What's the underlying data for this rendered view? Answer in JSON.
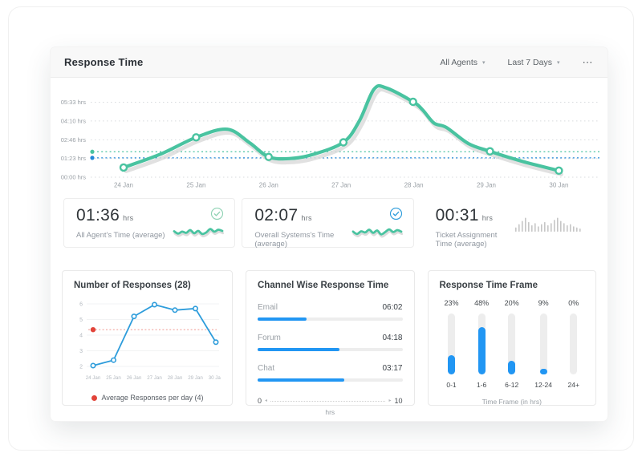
{
  "header": {
    "title": "Response Time",
    "filters": [
      {
        "label": "All Agents"
      },
      {
        "label": "Last 7 Days"
      }
    ],
    "menu_icon": "⋯"
  },
  "colors": {
    "teal": "#49c3a0",
    "teal_icon": "#8fd2b4",
    "blue": "#2196f3",
    "blue_line": "#2d9cdb",
    "ref_blue": "#2488d8",
    "red": "#e2443a",
    "red_light": "#f2a59f",
    "shadow_gray": "#dcdcdc",
    "waveform_gray": "#c6c6c6"
  },
  "stats": [
    {
      "value": "01:36",
      "unit": "hrs",
      "label": "All Agent's Time (average)",
      "icon": "check-circle",
      "icon_color": "#8fd2b4",
      "spark": [
        4.6,
        3.4,
        4.4,
        3.8,
        5.2,
        3.6,
        4.8,
        3.2,
        4.0,
        5.8,
        4.4,
        5.4,
        4.8
      ]
    },
    {
      "value": "02:07",
      "unit": "hrs",
      "label": "Overall Systems's Time (average)",
      "icon": "check-circle",
      "icon_color": "#2d9cdb",
      "spark": [
        4.4,
        3.2,
        4.6,
        4.0,
        5.4,
        3.8,
        5.0,
        3.0,
        4.2,
        5.6,
        4.2,
        5.2,
        4.4
      ]
    },
    {
      "value": "00:31",
      "unit": "hrs",
      "label": "Ticket Assignment Time (average)",
      "icon": "waveform",
      "waveform": [
        4,
        7,
        10,
        13,
        9,
        6,
        8,
        5,
        7,
        9,
        6,
        8,
        11,
        13,
        10,
        8,
        6,
        7,
        5,
        4,
        3
      ]
    }
  ],
  "chart_data": [
    {
      "id": "response_trend",
      "type": "line",
      "title": "Response Time",
      "x_labels": [
        "24 Jan",
        "25 Jan",
        "26 Jan",
        "27 Jan",
        "28 Jan",
        "29 Jan",
        "30 Jan"
      ],
      "y_tick_labels": [
        "05:33 hrs",
        "04:10 hrs",
        "02:46 hrs",
        "01:23 hrs",
        "00:00 hrs"
      ],
      "y_tick_minutes": [
        333,
        250,
        166,
        83,
        0
      ],
      "day_values_minutes": [
        43,
        177,
        90,
        155,
        335,
        115,
        29
      ],
      "curve": [
        [
          0,
          43
        ],
        [
          0.5,
          101
        ],
        [
          1,
          177
        ],
        [
          1.43,
          213
        ],
        [
          1.74,
          152
        ],
        [
          2,
          90
        ],
        [
          2.3,
          83
        ],
        [
          2.6,
          100
        ],
        [
          3.03,
          155
        ],
        [
          3.25,
          250
        ],
        [
          3.45,
          390
        ],
        [
          3.62,
          397
        ],
        [
          3.99,
          335
        ],
        [
          4.12,
          300
        ],
        [
          4.28,
          240
        ],
        [
          4.45,
          221
        ],
        [
          4.75,
          150
        ],
        [
          5.05,
          115
        ],
        [
          5.5,
          70
        ],
        [
          6,
          29
        ]
      ],
      "markers": [
        [
          0,
          43
        ],
        [
          1,
          177
        ],
        [
          2,
          90
        ],
        [
          3.03,
          155
        ],
        [
          3.99,
          335
        ],
        [
          5.05,
          115
        ],
        [
          6,
          29
        ]
      ],
      "reference_lines": [
        {
          "name": "overall-average",
          "minutes": 113,
          "color": "teal"
        },
        {
          "name": "agents-average",
          "minutes": 86,
          "color": "blue"
        }
      ]
    },
    {
      "id": "responses",
      "type": "line",
      "title": "Number of Responses (28)",
      "x_labels": [
        "24 Jan",
        "25 Jan",
        "26 Jan",
        "27 Jan",
        "28 Jan",
        "29 Jan",
        "30 Jan"
      ],
      "y_ticks": [
        2,
        3,
        4,
        5,
        6
      ],
      "values": [
        2.05,
        2.4,
        5.2,
        5.95,
        5.6,
        5.7,
        3.55
      ],
      "average_line": 4.35,
      "legend": "Average Responses per day (4)"
    },
    {
      "id": "channels",
      "type": "bar",
      "title": "Channel Wise Response Time",
      "rows": [
        {
          "label": "Email",
          "value": "06:02",
          "frac": 0.34
        },
        {
          "label": "Forum",
          "value": "04:18",
          "frac": 0.565
        },
        {
          "label": "Chat",
          "value": "03:17",
          "frac": 0.6
        }
      ],
      "axis": {
        "min": "0",
        "max": "10",
        "unit": "hrs"
      }
    },
    {
      "id": "timeframe",
      "type": "bar",
      "title": "Response Time Frame",
      "categories": [
        "0-1",
        "1-6",
        "6-12",
        "12-24",
        "24+"
      ],
      "pct_labels": [
        "23%",
        "48%",
        "20%",
        "9%",
        "0%"
      ],
      "fill_fracs": [
        0.31,
        0.78,
        0.22,
        0.09,
        0
      ],
      "xlabel": "Time Frame (in hrs)"
    }
  ]
}
